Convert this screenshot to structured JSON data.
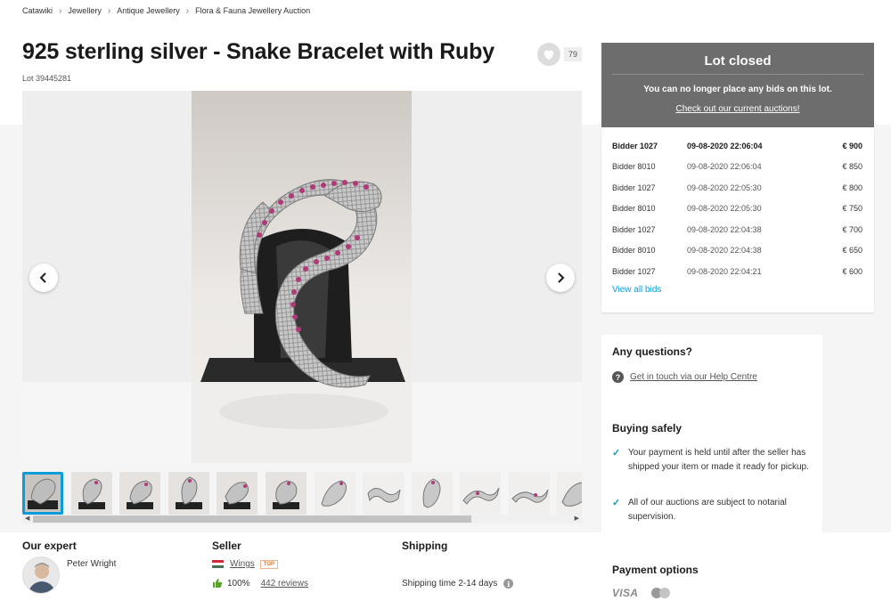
{
  "breadcrumb": [
    "Catawiki",
    "Jewellery",
    "Antique Jewellery",
    "Flora & Fauna Jewellery Auction"
  ],
  "title": "925 sterling silver - Snake Bracelet with Ruby",
  "lot_number": "Lot 39445281",
  "favourites_count": "79",
  "lot_closed": {
    "title": "Lot closed",
    "message": "You can no longer place any bids on this lot.",
    "link": "Check out our current auctions!"
  },
  "bids": [
    {
      "bidder": "Bidder 1027",
      "date": "09-08-2020 22:06:04",
      "amount": "€ 900"
    },
    {
      "bidder": "Bidder 8010",
      "date": "09-08-2020 22:06:04",
      "amount": "€ 850"
    },
    {
      "bidder": "Bidder 1027",
      "date": "09-08-2020 22:05:30",
      "amount": "€ 800"
    },
    {
      "bidder": "Bidder 8010",
      "date": "09-08-2020 22:05:30",
      "amount": "€ 750"
    },
    {
      "bidder": "Bidder 1027",
      "date": "09-08-2020 22:04:38",
      "amount": "€ 700"
    },
    {
      "bidder": "Bidder 8010",
      "date": "09-08-2020 22:04:38",
      "amount": "€ 650"
    },
    {
      "bidder": "Bidder 1027",
      "date": "09-08-2020 22:04:21",
      "amount": "€ 600"
    }
  ],
  "view_all_bids": "View all bids",
  "questions": {
    "heading": "Any questions?",
    "link": "Get in touch via our Help Centre"
  },
  "buying_safely": {
    "heading": "Buying safely",
    "items": [
      "Your payment is held until after the seller has shipped your item or made it ready for pickup.",
      "All of our auctions are subject to notarial supervision."
    ]
  },
  "expert": {
    "heading": "Our expert",
    "name": "Peter Wright"
  },
  "seller": {
    "heading": "Seller",
    "name": "Wings",
    "badge": "TOP",
    "rating": "100%",
    "reviews": "442 reviews"
  },
  "shipping": {
    "heading": "Shipping",
    "time": "Shipping time 2-14 days"
  },
  "payment": {
    "heading": "Payment options",
    "visa": "VISA"
  },
  "colors": {
    "accent": "#0a9cd8",
    "closed_panel": "#6d6d6d",
    "top_badge": "#e0762a",
    "rating": "#5aa02c"
  }
}
